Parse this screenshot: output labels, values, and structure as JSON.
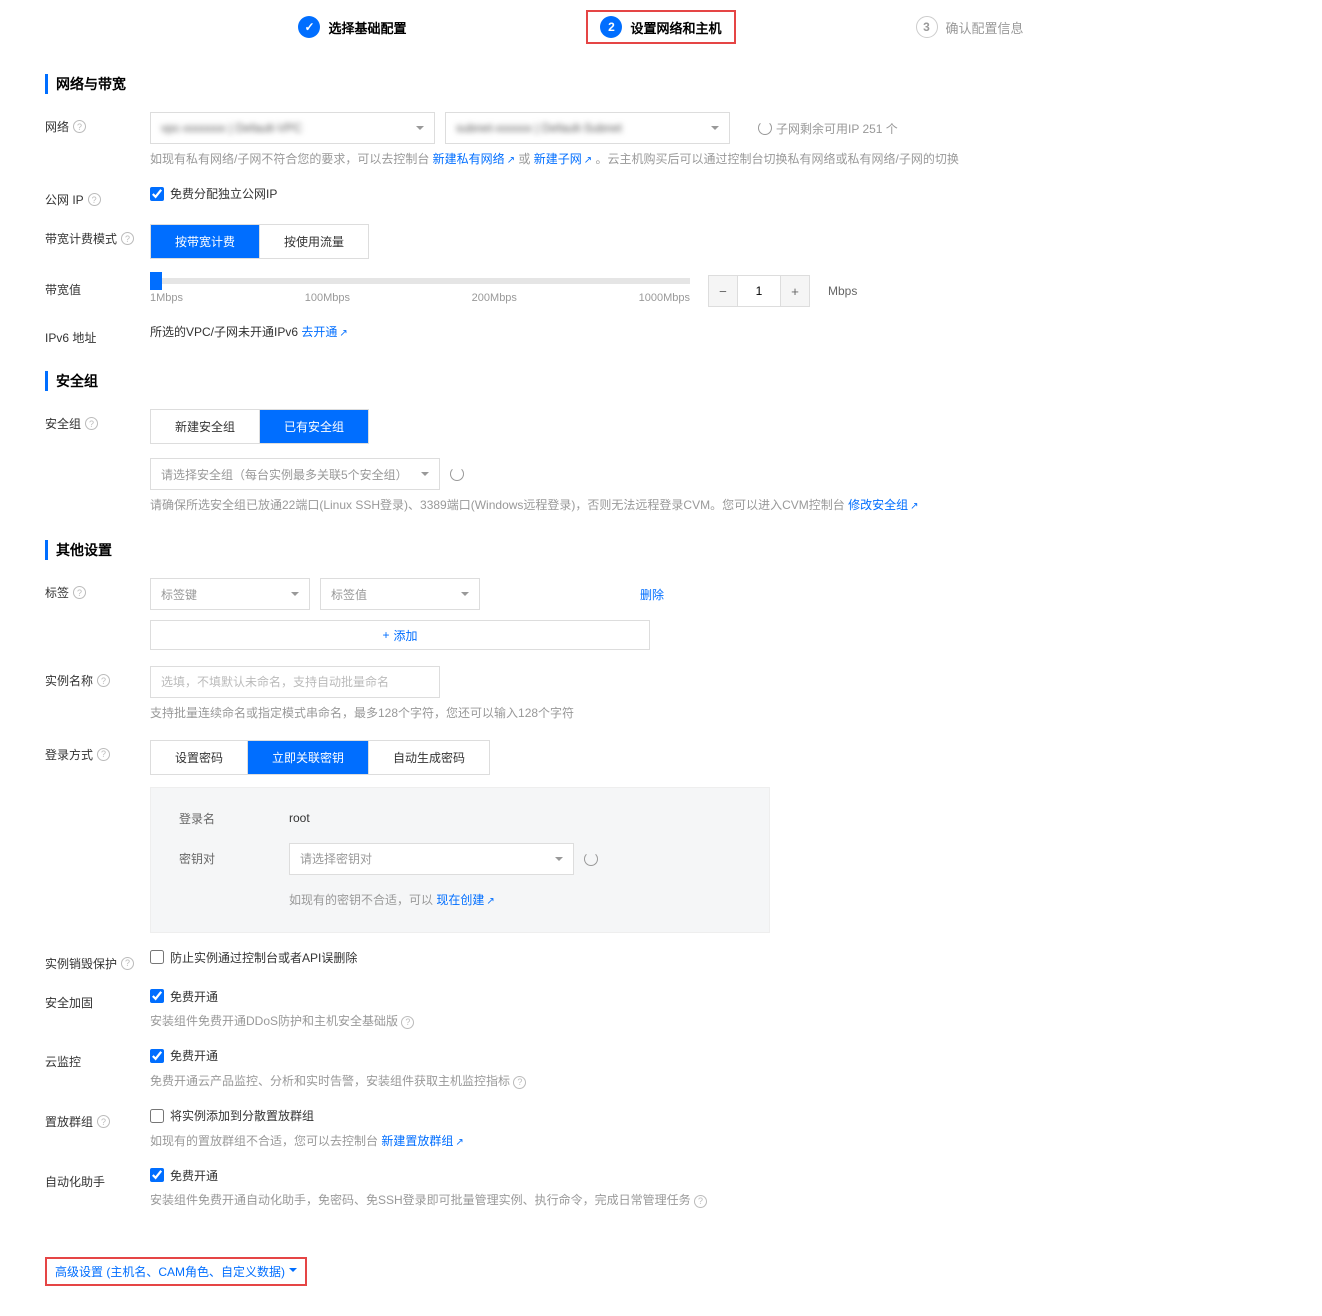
{
  "steps": {
    "s1": "选择基础配置",
    "s2_num": "2",
    "s2": "设置网络和主机",
    "s3_num": "3",
    "s3": "确认配置信息"
  },
  "section_network": "网络与带宽",
  "network": {
    "label": "网络",
    "hint_prefix": "如现有私有网络/子网不符合您的要求，可以去控制台 ",
    "link1": "新建私有网络",
    "mid": " 或 ",
    "link2": "新建子网",
    "hint_suffix": "。云主机购买后可以通过控制台切换私有网络或私有网络/子网的切换",
    "subnet_info": "子网剩余可用IP 251 个"
  },
  "public_ip": {
    "label": "公网 IP",
    "cb": "免费分配独立公网IP"
  },
  "bw_mode": {
    "label": "带宽计费模式",
    "t1": "按带宽计费",
    "t2": "按使用流量"
  },
  "bw_val": {
    "label": "带宽值",
    "tick1": "1Mbps",
    "tick2": "100Mbps",
    "tick3": "200Mbps",
    "tick4": "1000Mbps",
    "value": "1",
    "unit": "Mbps"
  },
  "ipv6": {
    "label": "IPv6 地址",
    "text": "所选的VPC/子网未开通IPv6  ",
    "link": "去开通"
  },
  "section_sg": "安全组",
  "sg": {
    "label": "安全组",
    "t1": "新建安全组",
    "t2": "已有安全组",
    "placeholder": "请选择安全组（每台实例最多关联5个安全组）",
    "hint": "请确保所选安全组已放通22端口(Linux SSH登录)、3389端口(Windows远程登录)，否则无法远程登录CVM。您可以进入CVM控制台 ",
    "link": "修改安全组"
  },
  "section_other": "其他设置",
  "tags": {
    "label": "标签",
    "key_ph": "标签键",
    "val_ph": "标签值",
    "del": "删除",
    "add": "添加"
  },
  "instname": {
    "label": "实例名称",
    "ph": "选填，不填默认未命名，支持自动批量命名",
    "hint": "支持批量连续命名或指定模式串命名，最多128个字符，您还可以输入128个字符"
  },
  "login": {
    "label": "登录方式",
    "t1": "设置密码",
    "t2": "立即关联密钥",
    "t3": "自动生成密码",
    "user_label": "登录名",
    "user_val": "root",
    "key_label": "密钥对",
    "key_ph": "请选择密钥对",
    "hint": "如现有的密钥不合适，可以 ",
    "link": "现在创建"
  },
  "destroy": {
    "label": "实例销毁保护",
    "cb": "防止实例通过控制台或者API误删除"
  },
  "sec": {
    "label": "安全加固",
    "cb": "免费开通",
    "hint": "安装组件免费开通DDoS防护和主机安全基础版 "
  },
  "monitor": {
    "label": "云监控",
    "cb": "免费开通",
    "hint": "免费开通云产品监控、分析和实时告警，安装组件获取主机监控指标 "
  },
  "placement": {
    "label": "置放群组",
    "cb": "将实例添加到分散置放群组",
    "hint": "如现有的置放群组不合适，您可以去控制台 ",
    "link": "新建置放群组"
  },
  "automation": {
    "label": "自动化助手",
    "cb": "免费开通",
    "hint": "安装组件免费开通自动化助手，免密码、免SSH登录即可批量管理实例、执行命令，完成日常管理任务 "
  },
  "advanced": "高级设置 (主机名、CAM角色、自定义数据)"
}
